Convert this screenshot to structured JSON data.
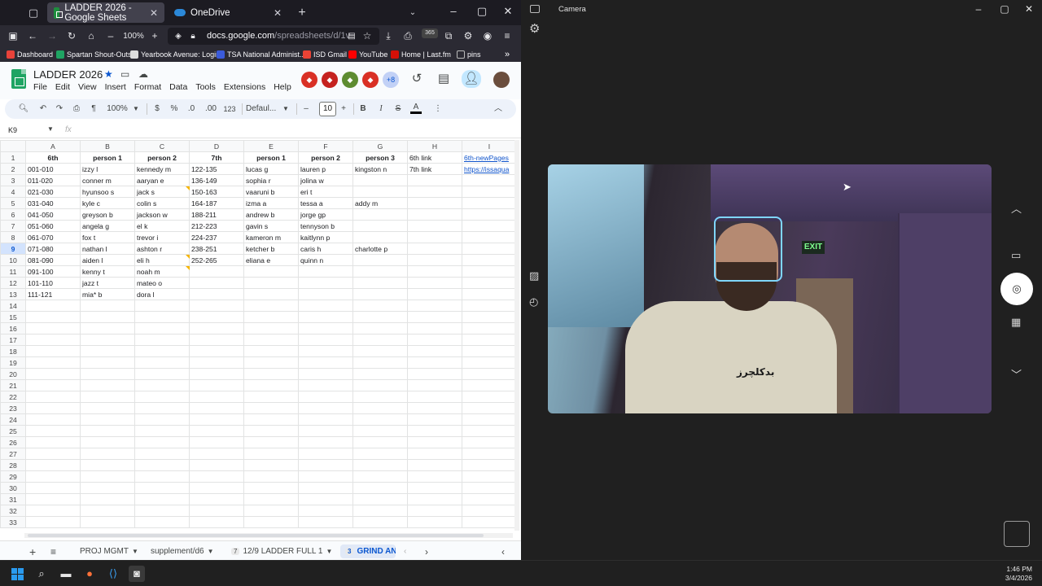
{
  "browser": {
    "tabs": [
      {
        "title": "LADDER 2026 - Google Sheets",
        "active": true
      },
      {
        "title": "OneDrive",
        "active": false
      }
    ],
    "zoom": "100%",
    "url_host": "docs.google.com",
    "url_path": "/spreadsheets/d/1v",
    "badge_365": "365",
    "bookmarks": [
      {
        "label": "Dashboard",
        "color": "#e8423a"
      },
      {
        "label": "Spartan Shout-Outs",
        "color": "#1fa463"
      },
      {
        "label": "Yearbook Avenue: Login",
        "color": "#dddddd"
      },
      {
        "label": "TSA National Administ...",
        "color": "#3b5bdb"
      },
      {
        "label": "ISD Gmail",
        "color": "#ea4335"
      },
      {
        "label": "YouTube",
        "color": "#ff0000"
      },
      {
        "label": "Home | Last.fm",
        "color": "#d51007"
      },
      {
        "label": "pins",
        "color": "#9a9a9a"
      }
    ]
  },
  "sheets": {
    "title": "LADDER 2026",
    "menu": [
      "File",
      "Edit",
      "View",
      "Insert",
      "Format",
      "Data",
      "Tools",
      "Extensions",
      "Help"
    ],
    "collaborators_more": "+8",
    "collaborator_colors": [
      "#d93025",
      "#c5221f",
      "#5e8c31",
      "#d93025"
    ],
    "toolbar": {
      "zoom": "100%",
      "currency": "$",
      "percent": "%",
      "decimal_dec": ".0",
      "decimal_inc": ".00",
      "number_format": "123",
      "font": "Defaul...",
      "font_size": "10",
      "bold": "B",
      "italic": "I"
    },
    "name_box": "K9",
    "fx": "fx",
    "columns": [
      "A",
      "B",
      "C",
      "D",
      "E",
      "F",
      "G",
      "H",
      "I"
    ],
    "rows": [
      [
        "6th",
        "person 1",
        "person 2",
        "7th",
        "person 1",
        "person 2",
        "person 3",
        "6th link",
        "6th-newPages"
      ],
      [
        "001-010",
        "izzy l",
        "kennedy m",
        "122-135",
        "lucas g",
        "lauren p",
        "kingston n",
        "7th link",
        "https://issaqua"
      ],
      [
        "011-020",
        "conner m",
        "aaryan e",
        "136-149",
        "sophia r",
        "jolina w",
        "",
        "",
        ""
      ],
      [
        "021-030",
        "hyunsoo s",
        "jack s",
        "150-163",
        "vaaruni b",
        "eri t",
        "",
        "",
        ""
      ],
      [
        "031-040",
        "kyle c",
        "colin s",
        "164-187",
        "izma a",
        "tessa a",
        "addy m",
        "",
        ""
      ],
      [
        "041-050",
        "greyson b",
        "jackson w",
        "188-211",
        "andrew b",
        "jorge gp",
        "",
        "",
        ""
      ],
      [
        "051-060",
        "angela g",
        "el k",
        "212-223",
        "gavin s",
        "tennyson b",
        "",
        "",
        ""
      ],
      [
        "061-070",
        "fox t",
        "trevor i",
        "224-237",
        "kameron m",
        "kaitlynn p",
        "",
        "",
        ""
      ],
      [
        "071-080",
        "nathan l",
        "ashton r",
        "238-251",
        "ketcher b",
        "caris h",
        "charlotte p",
        "",
        ""
      ],
      [
        "081-090",
        "aiden l",
        "eli h",
        "252-265",
        "eliana e",
        "quinn n",
        "",
        "",
        ""
      ],
      [
        "091-100",
        "kenny t",
        "noah m",
        "",
        "",
        "",
        "",
        "",
        ""
      ],
      [
        "101-110",
        "jazz t",
        "mateo o",
        "",
        "",
        "",
        "",
        "",
        ""
      ],
      [
        "111-121",
        "mia* b",
        "dora l",
        "",
        "",
        "",
        "",
        "",
        ""
      ]
    ],
    "total_rows": 33,
    "selected_row": 9,
    "sheet_tabs": [
      {
        "label": "PROJ MGMT",
        "badge": ""
      },
      {
        "label": "supplement/d6",
        "badge": ""
      },
      {
        "label": "12/9 LADDER FULL 1",
        "badge": "7"
      },
      {
        "label": "GRIND AN",
        "badge": "3",
        "active": true
      }
    ]
  },
  "camera": {
    "title": "Camera",
    "shirt_text": "بدكلچرز"
  },
  "taskbar": {
    "time": "1:46 PM",
    "date": "3/4/2026"
  }
}
